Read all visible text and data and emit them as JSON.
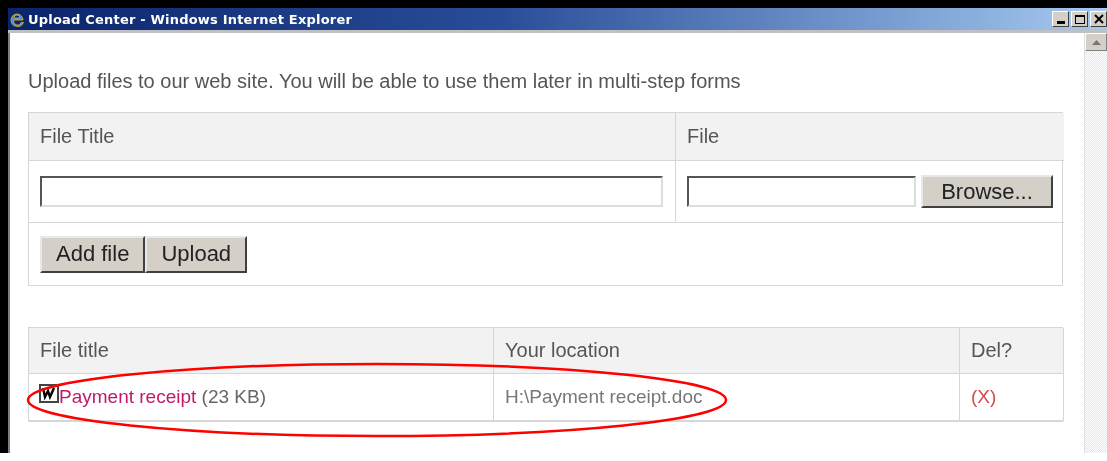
{
  "window": {
    "title": "Upload Center - Windows Internet Explorer"
  },
  "intro": "Upload files to our web site. You will be able to use them later in multi-step forms",
  "upload_form": {
    "columns": [
      "File Title",
      "File"
    ],
    "browse_button": "Browse...",
    "buttons": [
      "Add file",
      "Upload"
    ]
  },
  "files_table": {
    "columns": [
      "File title",
      "Your location",
      "Del?"
    ],
    "rows": [
      {
        "title": "Payment receipt",
        "size": "(23 KB)",
        "location": "H:\\Payment receipt.doc",
        "delete": "(X)"
      }
    ]
  },
  "annotation": {
    "kind": "ellipse",
    "color": "#ff0000"
  }
}
